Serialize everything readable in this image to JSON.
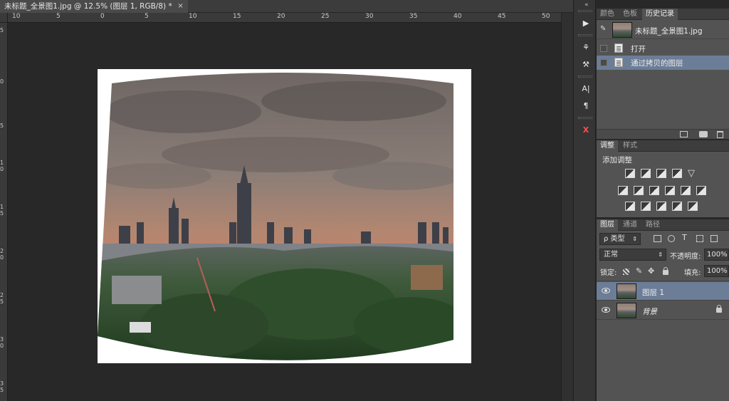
{
  "document": {
    "tab_title": "未标题_全景图1.jpg @ 12.5% (图层 1, RGB/8) *",
    "close_glyph": "×"
  },
  "ruler": {
    "top_labels": [
      "10",
      "5",
      "0",
      "5",
      "10",
      "15",
      "20",
      "25",
      "30",
      "35",
      "40",
      "45",
      "50"
    ],
    "left_labels": [
      "5",
      "0",
      "5",
      "1 0",
      "1 5",
      "2 0",
      "2 5",
      "3 0",
      "3 5"
    ]
  },
  "tool_strip": {
    "collapse_arrows": "«",
    "buttons": [
      {
        "name": "play-icon",
        "glyph": "▶"
      },
      {
        "name": "brush-preset-icon",
        "glyph": "⚘"
      },
      {
        "name": "tool-presets-icon",
        "glyph": "⚒"
      },
      {
        "name": "character-icon",
        "glyph": "A|"
      },
      {
        "name": "paragraph-icon",
        "glyph": "¶"
      },
      {
        "name": "x-tool-icon",
        "glyph": "X"
      }
    ]
  },
  "history_panel": {
    "tabs": [
      "颜色",
      "色板",
      "历史记录"
    ],
    "active_tab": "历史记录",
    "snapshot_name": "未标题_全景图1.jpg",
    "states": [
      {
        "label": "打开",
        "selected": false
      },
      {
        "label": "通过拷贝的图层",
        "selected": true
      }
    ],
    "footer_icons": [
      "new-document-from-state-icon",
      "camera-snapshot-icon",
      "trash-icon"
    ]
  },
  "adjustments_panel": {
    "tabs": [
      "调整",
      "样式"
    ],
    "active_tab": "调整",
    "heading": "添加调整",
    "icon_rows": [
      [
        "brightness-icon",
        "levels-icon",
        "curves-icon",
        "exposure-icon",
        "vibrance-icon"
      ],
      [
        "hue-saturation-icon",
        "color-balance-icon",
        "black-white-icon",
        "photo-filter-icon",
        "channel-mixer-icon",
        "color-lookup-icon"
      ],
      [
        "invert-icon",
        "posterize-icon",
        "threshold-icon",
        "selective-color-icon",
        "gradient-map-icon"
      ]
    ]
  },
  "layers_panel": {
    "tabs": [
      "图层",
      "通道",
      "路径"
    ],
    "active_tab": "图层",
    "filter_kind": "ρ 类型",
    "blend_mode": "正常",
    "opacity_label": "不透明度:",
    "opacity_value": "100%",
    "lock_label": "锁定:",
    "fill_label": "填充:",
    "fill_value": "100%",
    "layers": [
      {
        "name": "图层 1",
        "selected": true,
        "locked": false,
        "italic": false
      },
      {
        "name": "背景",
        "selected": false,
        "locked": true,
        "italic": true
      }
    ]
  },
  "colors": {
    "selection": "#6c7d97",
    "panel_bg": "#535353",
    "canvas_bg": "#282828"
  }
}
